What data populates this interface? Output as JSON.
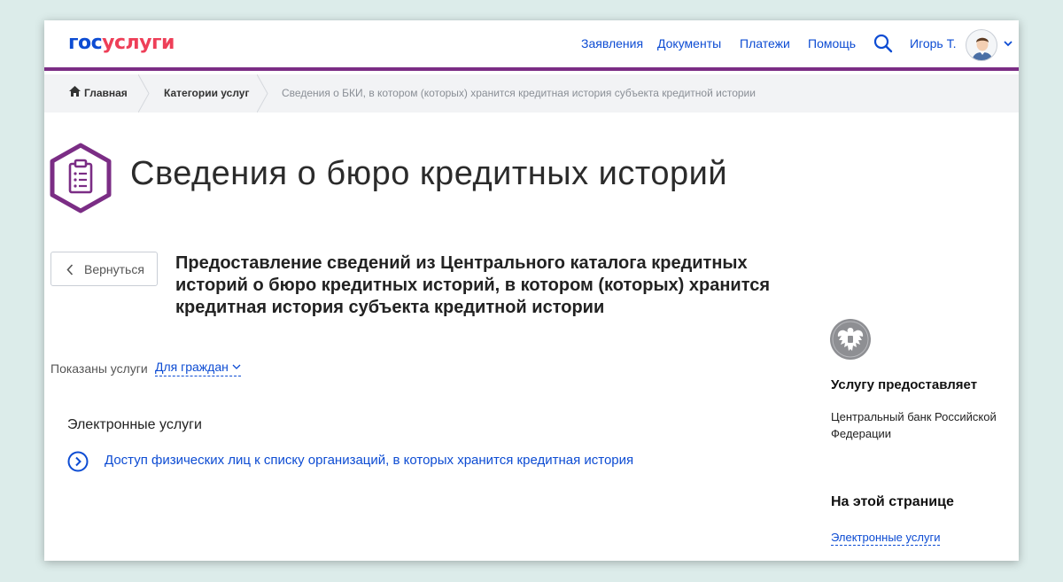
{
  "colors": {
    "brand_blue": "#0d4cd3",
    "brand_red": "#ee3f58",
    "accent_purple": "#7b2d85"
  },
  "header": {
    "logo_part1": "гос",
    "logo_part2": "услуги",
    "nav": [
      "Заявления",
      "Документы",
      "Платежи",
      "Помощь"
    ],
    "search_icon": "search-icon",
    "user_name": "Игорь Т."
  },
  "breadcrumb": {
    "home": "Главная",
    "category": "Категории услуг",
    "current": "Сведения о БКИ, в котором (которых) хранится кредитная история субъекта кредитной истории"
  },
  "page": {
    "title": "Сведения о бюро кредитных историй",
    "title_icon": "clipboard-icon",
    "back_label": "Вернуться",
    "service_heading": "Предоставление сведений из Центрального каталога кредитных историй о бюро кредитных историй, в котором (которых) хранится кредитная история субъекта кредитной истории",
    "filter_label": "Показаны услуги",
    "filter_value": "Для граждан",
    "section_title": "Электронные услуги",
    "service_link": "Доступ физических лиц к списку организаций, в которых хранится кредитная история"
  },
  "sidebar": {
    "emblem_icon": "central-bank-emblem-icon",
    "provider_title": "Услугу предоставляет",
    "provider_name": "Центральный банк Российской Федерации",
    "onpage_title": "На этой странице",
    "onpage_link": "Электронные услуги"
  }
}
